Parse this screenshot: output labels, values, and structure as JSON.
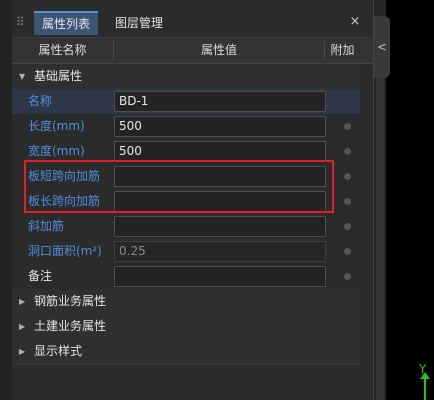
{
  "tabs": [
    {
      "label": "属性列表",
      "active": true
    },
    {
      "label": "图层管理",
      "active": false
    }
  ],
  "close_glyph": "×",
  "grip_glyph": "⠿",
  "header": {
    "name": "属性名称",
    "value": "属性值",
    "extra": "附加"
  },
  "groups": {
    "basic": {
      "label": "基础属性",
      "expanded": true
    },
    "rebar": {
      "label": "钢筋业务属性",
      "expanded": false
    },
    "civil": {
      "label": "土建业务属性",
      "expanded": false
    },
    "display": {
      "label": "显示样式",
      "expanded": false
    }
  },
  "properties": [
    {
      "name": "名称",
      "value": "BD-1",
      "style": "blue",
      "editable": true
    },
    {
      "name": "长度(mm)",
      "value": "500",
      "style": "blue",
      "editable": true
    },
    {
      "name": "宽度(mm)",
      "value": "500",
      "style": "blue",
      "editable": true
    },
    {
      "name": "板短跨向加筋",
      "value": "",
      "style": "blue",
      "editable": true
    },
    {
      "name": "板长跨向加筋",
      "value": "",
      "style": "blue",
      "editable": true
    },
    {
      "name": "斜加筋",
      "value": "",
      "style": "blue",
      "editable": true
    },
    {
      "name": "洞口面积(m²)",
      "value": "0.25",
      "style": "blue",
      "editable": false
    },
    {
      "name": "备注",
      "value": "",
      "style": "white",
      "editable": true
    }
  ],
  "collapse_glyph": "<",
  "axis_label": "Y",
  "colors": {
    "accent": "#3d5575",
    "label_blue": "#4f8fdc",
    "highlight": "#e0202a",
    "axis": "#22c41f"
  }
}
